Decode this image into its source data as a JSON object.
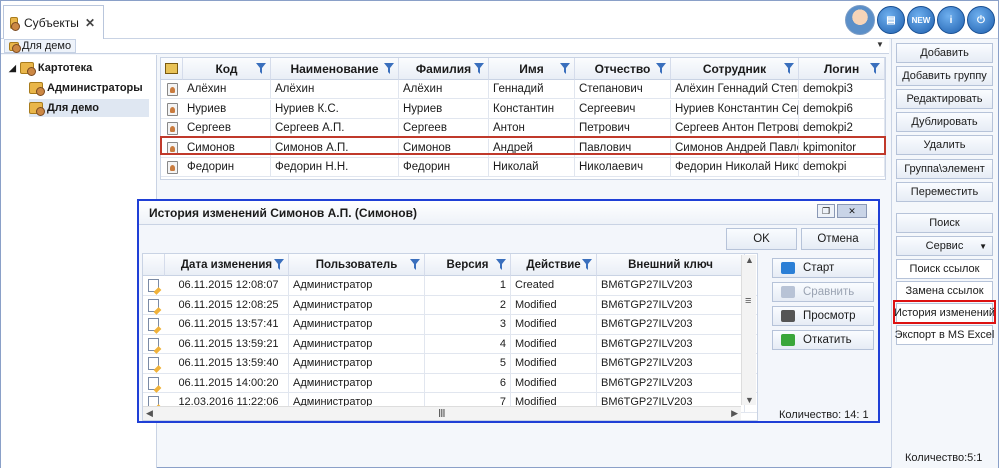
{
  "window": {
    "tab_label": "Субъекты",
    "tab_close": "✕",
    "breadcrumb": "Для демо",
    "count_label": "Количество:5:1"
  },
  "top_icons": [
    "avatar-icon",
    "book-icon",
    "news-icon",
    "info-icon",
    "power-icon"
  ],
  "tree": {
    "root": "Картотека",
    "children": [
      "Администраторы",
      "Для демо"
    ],
    "selected": "Для демо"
  },
  "grid": {
    "headers": [
      "Код",
      "Наименование",
      "Фамилия",
      "Имя",
      "Отчество",
      "Сотрудник",
      "Логин"
    ],
    "rows": [
      [
        "Алёхин",
        "Алёхин",
        "Алёхин",
        "Геннадий",
        "Степанович",
        "Алёхин Геннадий Степано",
        "demokpi3"
      ],
      [
        "Нуриев",
        "Нуриев К.С.",
        "Нуриев",
        "Константин",
        "Сергеевич",
        "Нуриев Константин Серге",
        "demokpi6"
      ],
      [
        "Сергеев",
        "Сергеев А.П.",
        "Сергеев",
        "Антон",
        "Петрович",
        "Сергеев Антон Петрович",
        "demokpi2"
      ],
      [
        "Симонов",
        "Симонов А.П.",
        "Симонов",
        "Андрей",
        "Павлович",
        "Симонов Андрей Павлови",
        "kpimonitor"
      ],
      [
        "Федорин",
        "Федорин Н.Н.",
        "Федорин",
        "Николай",
        "Николаевич",
        "Федорин Николай Никола",
        "demokpi"
      ]
    ],
    "selected_row": 3
  },
  "side_buttons": [
    "Добавить",
    "Добавить группу",
    "Редактировать",
    "Дублировать",
    "Удалить",
    "Группа\\элемент",
    "Переместить",
    "Поиск",
    "Сервис"
  ],
  "service_menu": [
    "Поиск ссылок",
    "Замена ссылок",
    "История изменений",
    "Экспорт в MS Excel"
  ],
  "highlighted_menu": "История изменений",
  "dialog": {
    "title": "История изменений Симонов А.П. (Симонов)",
    "ok": "OK",
    "cancel": "Отмена",
    "headers": [
      "Дата изменения",
      "Пользователь",
      "Версия",
      "Действие",
      "Внешний ключ"
    ],
    "rows": [
      [
        "06.11.2015 12:08:07",
        "Администратор",
        "1",
        "Created",
        "BM6TGP27ILV203"
      ],
      [
        "06.11.2015 12:08:25",
        "Администратор",
        "2",
        "Modified",
        "BM6TGP27ILV203"
      ],
      [
        "06.11.2015 13:57:41",
        "Администратор",
        "3",
        "Modified",
        "BM6TGP27ILV203"
      ],
      [
        "06.11.2015 13:59:21",
        "Администратор",
        "4",
        "Modified",
        "BM6TGP27ILV203"
      ],
      [
        "06.11.2015 13:59:40",
        "Администратор",
        "5",
        "Modified",
        "BM6TGP27ILV203"
      ],
      [
        "06.11.2015 14:00:20",
        "Администратор",
        "6",
        "Modified",
        "BM6TGP27ILV203"
      ],
      [
        "12.03.2016 11:22:06",
        "Администратор",
        "7",
        "Modified",
        "BM6TGP27ILV203"
      ]
    ],
    "actions": [
      "Старт",
      "Сравнить",
      "Просмотр",
      "Откатить"
    ],
    "disabled_actions": [
      "Сравнить"
    ],
    "count": "Количество: 14: 1"
  },
  "colors": {
    "accent": "#1f3fd6",
    "selection_border": "#c0392b",
    "highlight": "#dd1111"
  }
}
